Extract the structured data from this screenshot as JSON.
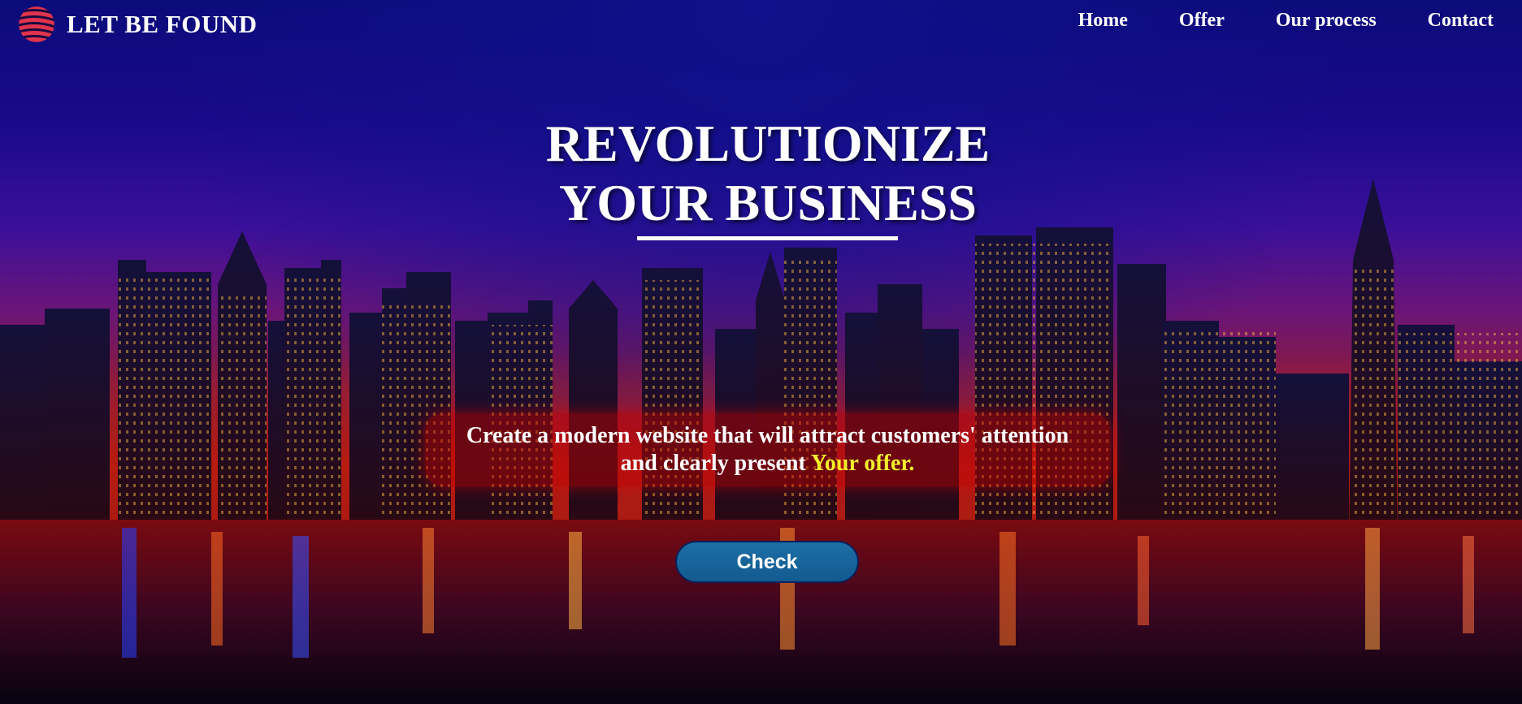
{
  "header": {
    "brand": "LET BE FOUND",
    "nav": [
      {
        "label": "Home"
      },
      {
        "label": "Offer"
      },
      {
        "label": "Our process"
      },
      {
        "label": "Contact"
      }
    ]
  },
  "hero": {
    "title_line1": "REVOLUTIONIZE",
    "title_line2": "YOUR BUSINESS",
    "tagline_line1": "Create a modern website that will attract customers' attention",
    "tagline_line2_prefix": "and clearly present",
    "tagline_accent": "Your offer.",
    "cta_label": "Check"
  },
  "colors": {
    "accent_yellow": "#f2ee2a",
    "button_blue": "#1c6fa6",
    "logo_red": "#e0334e"
  },
  "icons": {
    "logo": "striped-globe-icon"
  }
}
